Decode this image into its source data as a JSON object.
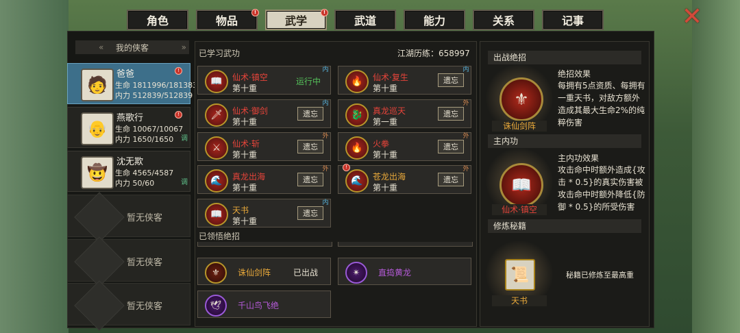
{
  "tabs": [
    {
      "label": "角色",
      "badge": false,
      "active": false
    },
    {
      "label": "物品",
      "badge": true,
      "active": false
    },
    {
      "label": "武学",
      "badge": true,
      "active": true
    },
    {
      "label": "武道",
      "badge": false,
      "active": false
    },
    {
      "label": "能力",
      "badge": false,
      "active": false
    },
    {
      "label": "关系",
      "badge": false,
      "active": false
    },
    {
      "label": "记事",
      "badge": false,
      "active": false
    }
  ],
  "close_icon": "close-x-icon",
  "party": {
    "title": "我的侠客",
    "heroes": [
      {
        "name": "爸爸",
        "hp": "生命 1811996/1813837",
        "mp": "内力 512839/512839",
        "tiao": "",
        "avatar": "hero-portrait-icon"
      },
      {
        "name": "燕歌行",
        "hp": "生命 10067/10067",
        "mp": "内力 1650/1650",
        "tiao": "调",
        "avatar": "white-hair-portrait-icon"
      },
      {
        "name": "沈无欺",
        "hp": "生命 4565/4587",
        "mp": "内力 50/60",
        "tiao": "调",
        "avatar": "hat-portrait-icon"
      }
    ],
    "empty_label": "暂无侠客"
  },
  "skills": {
    "title": "已学习武功",
    "exp": "江湖历练：658997",
    "items": [
      {
        "name": "仙术·镇空",
        "level": "第十重",
        "action": "运行中",
        "tag": "内",
        "color": "red",
        "icon": "book-icon",
        "badge": false
      },
      {
        "name": "仙术·复生",
        "level": "第十重",
        "action": "遗忘",
        "tag": "内",
        "color": "red",
        "icon": "flame-icon",
        "badge": false
      },
      {
        "name": "仙术·御剑",
        "level": "第十重",
        "action": "遗忘",
        "tag": "内",
        "color": "red",
        "icon": "sword-icon",
        "badge": false
      },
      {
        "name": "真龙巡天",
        "level": "第一重",
        "action": "遗忘",
        "tag": "外",
        "color": "red",
        "icon": "dragon-icon",
        "badge": false
      },
      {
        "name": "仙术·斩",
        "level": "第十重",
        "action": "遗忘",
        "tag": "外",
        "color": "red",
        "icon": "slash-icon",
        "badge": false
      },
      {
        "name": "火拳",
        "level": "第十重",
        "action": "遗忘",
        "tag": "外",
        "color": "red",
        "icon": "fire-fist-icon",
        "badge": false
      },
      {
        "name": "真龙出海",
        "level": "第十重",
        "action": "遗忘",
        "tag": "外",
        "color": "red",
        "icon": "wave-icon",
        "badge": false
      },
      {
        "name": "苍龙出海",
        "level": "第十重",
        "action": "遗忘",
        "tag": "外",
        "color": "gold",
        "icon": "wave-icon",
        "badge": true
      },
      {
        "name": "天书",
        "level": "第十重",
        "action": "遗忘",
        "tag": "内",
        "color": "gold",
        "icon": "book-icon",
        "badge": false
      }
    ]
  },
  "ultimates": {
    "title": "已领悟绝招",
    "items": [
      {
        "name": "诛仙剑阵",
        "status": "已出战",
        "color": "gold",
        "icon": "sword-array-icon"
      },
      {
        "name": "直捣黄龙",
        "status": "",
        "color": "purple",
        "icon": "dragon-strike-icon"
      },
      {
        "name": "千山鸟飞绝",
        "status": "",
        "color": "purple",
        "icon": "birds-icon"
      }
    ]
  },
  "battle": {
    "title": "出战绝招",
    "name": "诛仙剑阵",
    "effect_title": "绝招效果",
    "effect": "每拥有5点资质、每拥有一重天书，对敌方额外造成其最大生命2%的纯粹伤害"
  },
  "main_inner": {
    "title": "主内功",
    "name": "仙术·镇空",
    "effect_title": "主内功效果",
    "effect": "攻击命中时额外造成{攻击 * 0.5}的真实伤害被攻击命中时额外降低{防御 * 0.5}的所受伤害"
  },
  "manual": {
    "title": "修炼秘籍",
    "name": "天书",
    "status": "秘籍已修炼至最高重"
  },
  "colors": {
    "red": "#e6443a",
    "gold": "#e8a83a",
    "purple": "#b55ad8",
    "running": "#55c25a",
    "selected": "#3d6f8a"
  }
}
